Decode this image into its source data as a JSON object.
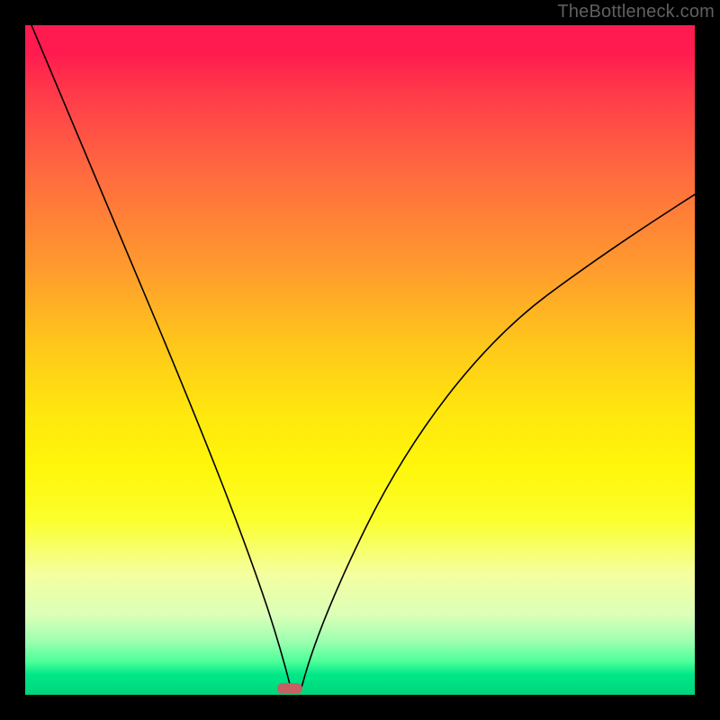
{
  "watermark": "TheBottleneck.com",
  "colors": {
    "frame_border": "#000000",
    "curve_stroke": "#000000",
    "marker_fill": "#c76062",
    "gradient_top": "#ff1a4f",
    "gradient_bottom": "#00d47c"
  },
  "chart_data": {
    "type": "line",
    "title": "",
    "xlabel": "",
    "ylabel": "",
    "xlim": [
      0,
      100
    ],
    "ylim": [
      0,
      100
    ],
    "legend": false,
    "notes": "Bottleneck-style V curve over a vertical red→green gradient. Values read as percentage of plot height (100 = top, 0 = bottom). Marker sits at the curve minimum.",
    "series": [
      {
        "name": "left-branch",
        "x": [
          1,
          6,
          12,
          18,
          24,
          30,
          34,
          37,
          38.5
        ],
        "values": [
          100,
          87,
          71,
          55,
          39,
          23,
          11,
          3,
          0.5
        ]
      },
      {
        "name": "right-branch",
        "x": [
          40.5,
          44,
          50,
          58,
          66,
          74,
          82,
          90,
          98,
          100
        ],
        "values": [
          0.5,
          6,
          17,
          32,
          45,
          55,
          63,
          69,
          74,
          75
        ]
      }
    ],
    "marker": {
      "x": 39.5,
      "y": 0.5
    }
  }
}
